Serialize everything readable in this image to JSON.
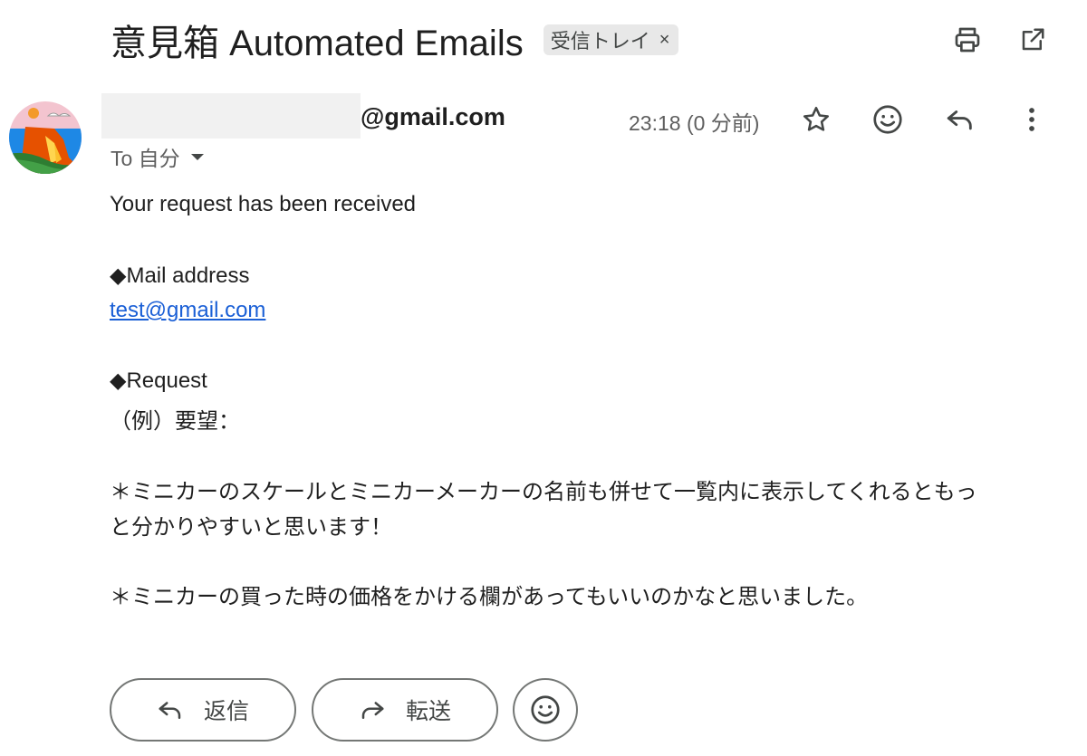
{
  "email": {
    "subject": "意見箱 Automated Emails",
    "label": "受信トレイ",
    "label_remove": "×",
    "sender_email": "@gmail.com",
    "timestamp": "23:18 (0 分前)",
    "recipient": "To 自分"
  },
  "body": {
    "line1": "Your request has been received",
    "mail_heading": "◆Mail address",
    "mail_value": "test@gmail.com",
    "request_heading": "◆Request",
    "request_example": "（例）要望：",
    "request_text_1a": "＊ミニカーのスケールとミニカーメーカーの名前も併せて一覧内に表示してくれるともっ",
    "request_text_1b": "と分かりやすいと思います！",
    "request_text_2": "＊ミニカーの買った時の価格をかける欄があってもいいのかなと思いました。"
  },
  "actions": {
    "reply_label": "返信",
    "forward_label": "転送"
  },
  "icons": {
    "print": "print-icon",
    "open_new_window": "open-in-new-window-icon",
    "star": "star-icon",
    "emoji": "emoji-icon",
    "reply": "reply-icon",
    "more": "more-vertical-icon",
    "forward": "forward-icon",
    "avatar": "avatar-image"
  },
  "colors": {
    "link": "#1a5fd6",
    "label_chip_bg": "#e8e8e8",
    "secondary_text": "#5e5e5e"
  }
}
